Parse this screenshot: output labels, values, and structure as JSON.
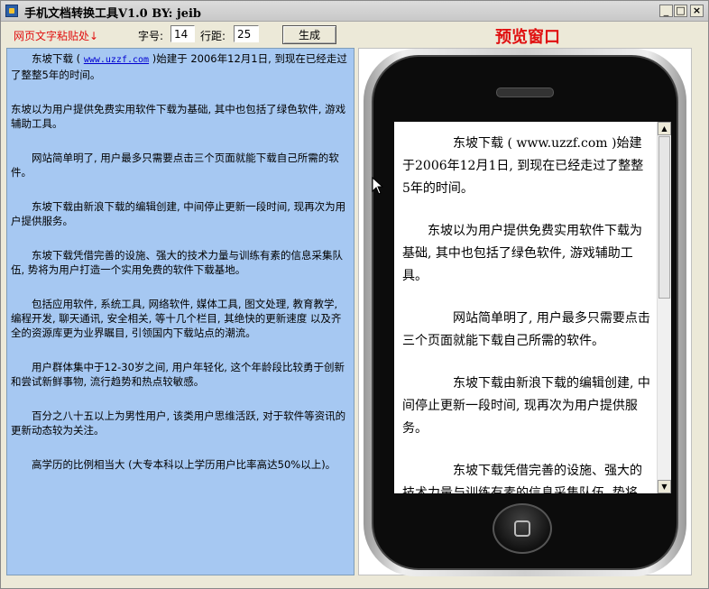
{
  "window": {
    "title": "手机文档转换工具V1.0 BY: jeib",
    "controls": {
      "minimize": "_",
      "maximize": "□",
      "close": "×"
    }
  },
  "toolbar": {
    "paste_label": "网页文字粘贴处↓",
    "font_size_label": "字号:",
    "font_size_value": "14",
    "line_spacing_label": "行距:",
    "line_spacing_value": "25",
    "generate_label": "生成",
    "preview_title": "预览窗口"
  },
  "input": {
    "p1_before": "东坡下载 ( ",
    "p1_link": "www.uzzf.com",
    "p1_after": " )始建于 2006年12月1日, 到现在已经走过了整整5年的时间。",
    "paragraphs": [
      "东坡以为用户提供免费实用软件下载为基础, 其中也包括了绿色软件, 游戏辅助工具。",
      "网站简单明了, 用户最多只需要点击三个页面就能下载自己所需的软件。",
      "东坡下载由新浪下载的编辑创建, 中间停止更新一段时间, 现再次为用户提供服务。",
      "东坡下载凭借完善的设施、强大的技术力量与训练有素的信息采集队伍, 势将为用户打造一个实用免费的软件下载基地。",
      "包括应用软件, 系统工具, 网络软件, 媒体工具, 图文处理, 教育教学, 编程开发, 聊天通讯, 安全相关, 等十几个栏目, 其绝快的更新速度 以及齐全的资源库更为业界瞩目, 引领国内下载站点的潮流。",
      "用户群体集中于12-30岁之间, 用户年轻化, 这个年龄段比较勇于创新和尝试新鲜事物, 流行趋势和热点较敏感。",
      "百分之八十五以上为男性用户, 该类用户思维活跃, 对于软件等资讯的更新动态较为关注。",
      "高学历的比例相当大 (大专本科以上学历用户比率高达50%以上)。"
    ]
  },
  "preview": {
    "paragraphs": [
      "东坡下载 ( www.uzzf.com )始建于2006年12月1日, 到现在已经走过了整整5年的时间。",
      "东坡以为用户提供免费实用软件下载为基础, 其中也包括了绿色软件, 游戏辅助工具。",
      "网站简单明了, 用户最多只需要点击三个页面就能下载自己所需的软件。",
      "东坡下载由新浪下载的编辑创建, 中间停止更新一段时间, 现再次为用户提供服务。",
      "东坡下载凭借完善的设施、强大的技术力量与训练有素的信息采集队伍, 势将"
    ],
    "scroll_up": "▲",
    "scroll_down": "▼"
  }
}
